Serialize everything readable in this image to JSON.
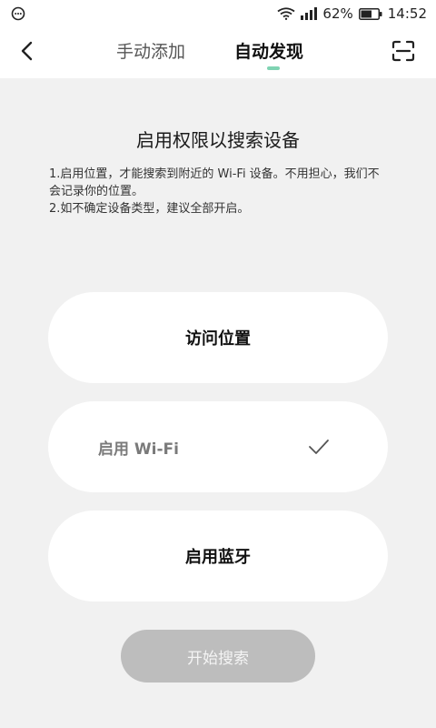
{
  "status_bar": {
    "battery_percent": "62%",
    "time": "14:52",
    "icons": [
      "message-bubble-icon",
      "wifi-icon",
      "signal-icon",
      "battery-icon"
    ]
  },
  "header": {
    "tabs": [
      {
        "label": "手动添加",
        "active": false
      },
      {
        "label": "自动发现",
        "active": true
      }
    ],
    "back_icon": "back-arrow-icon",
    "scan_icon": "scan-icon",
    "accent_color": "#7fd3b2"
  },
  "main": {
    "title": "启用权限以搜索设备",
    "desc_lines": [
      "1.启用位置，才能搜索到附近的 Wi-Fi 设备。不用担心，我们不会记录你的位置。",
      "2.如不确定设备类型，建议全部开启。"
    ],
    "permissions": [
      {
        "label": "访问位置",
        "enabled": false
      },
      {
        "label": "启用 Wi-Fi",
        "enabled": true
      },
      {
        "label": "启用蓝牙",
        "enabled": false
      }
    ],
    "start_button": "开始搜索",
    "start_button_enabled": false
  }
}
